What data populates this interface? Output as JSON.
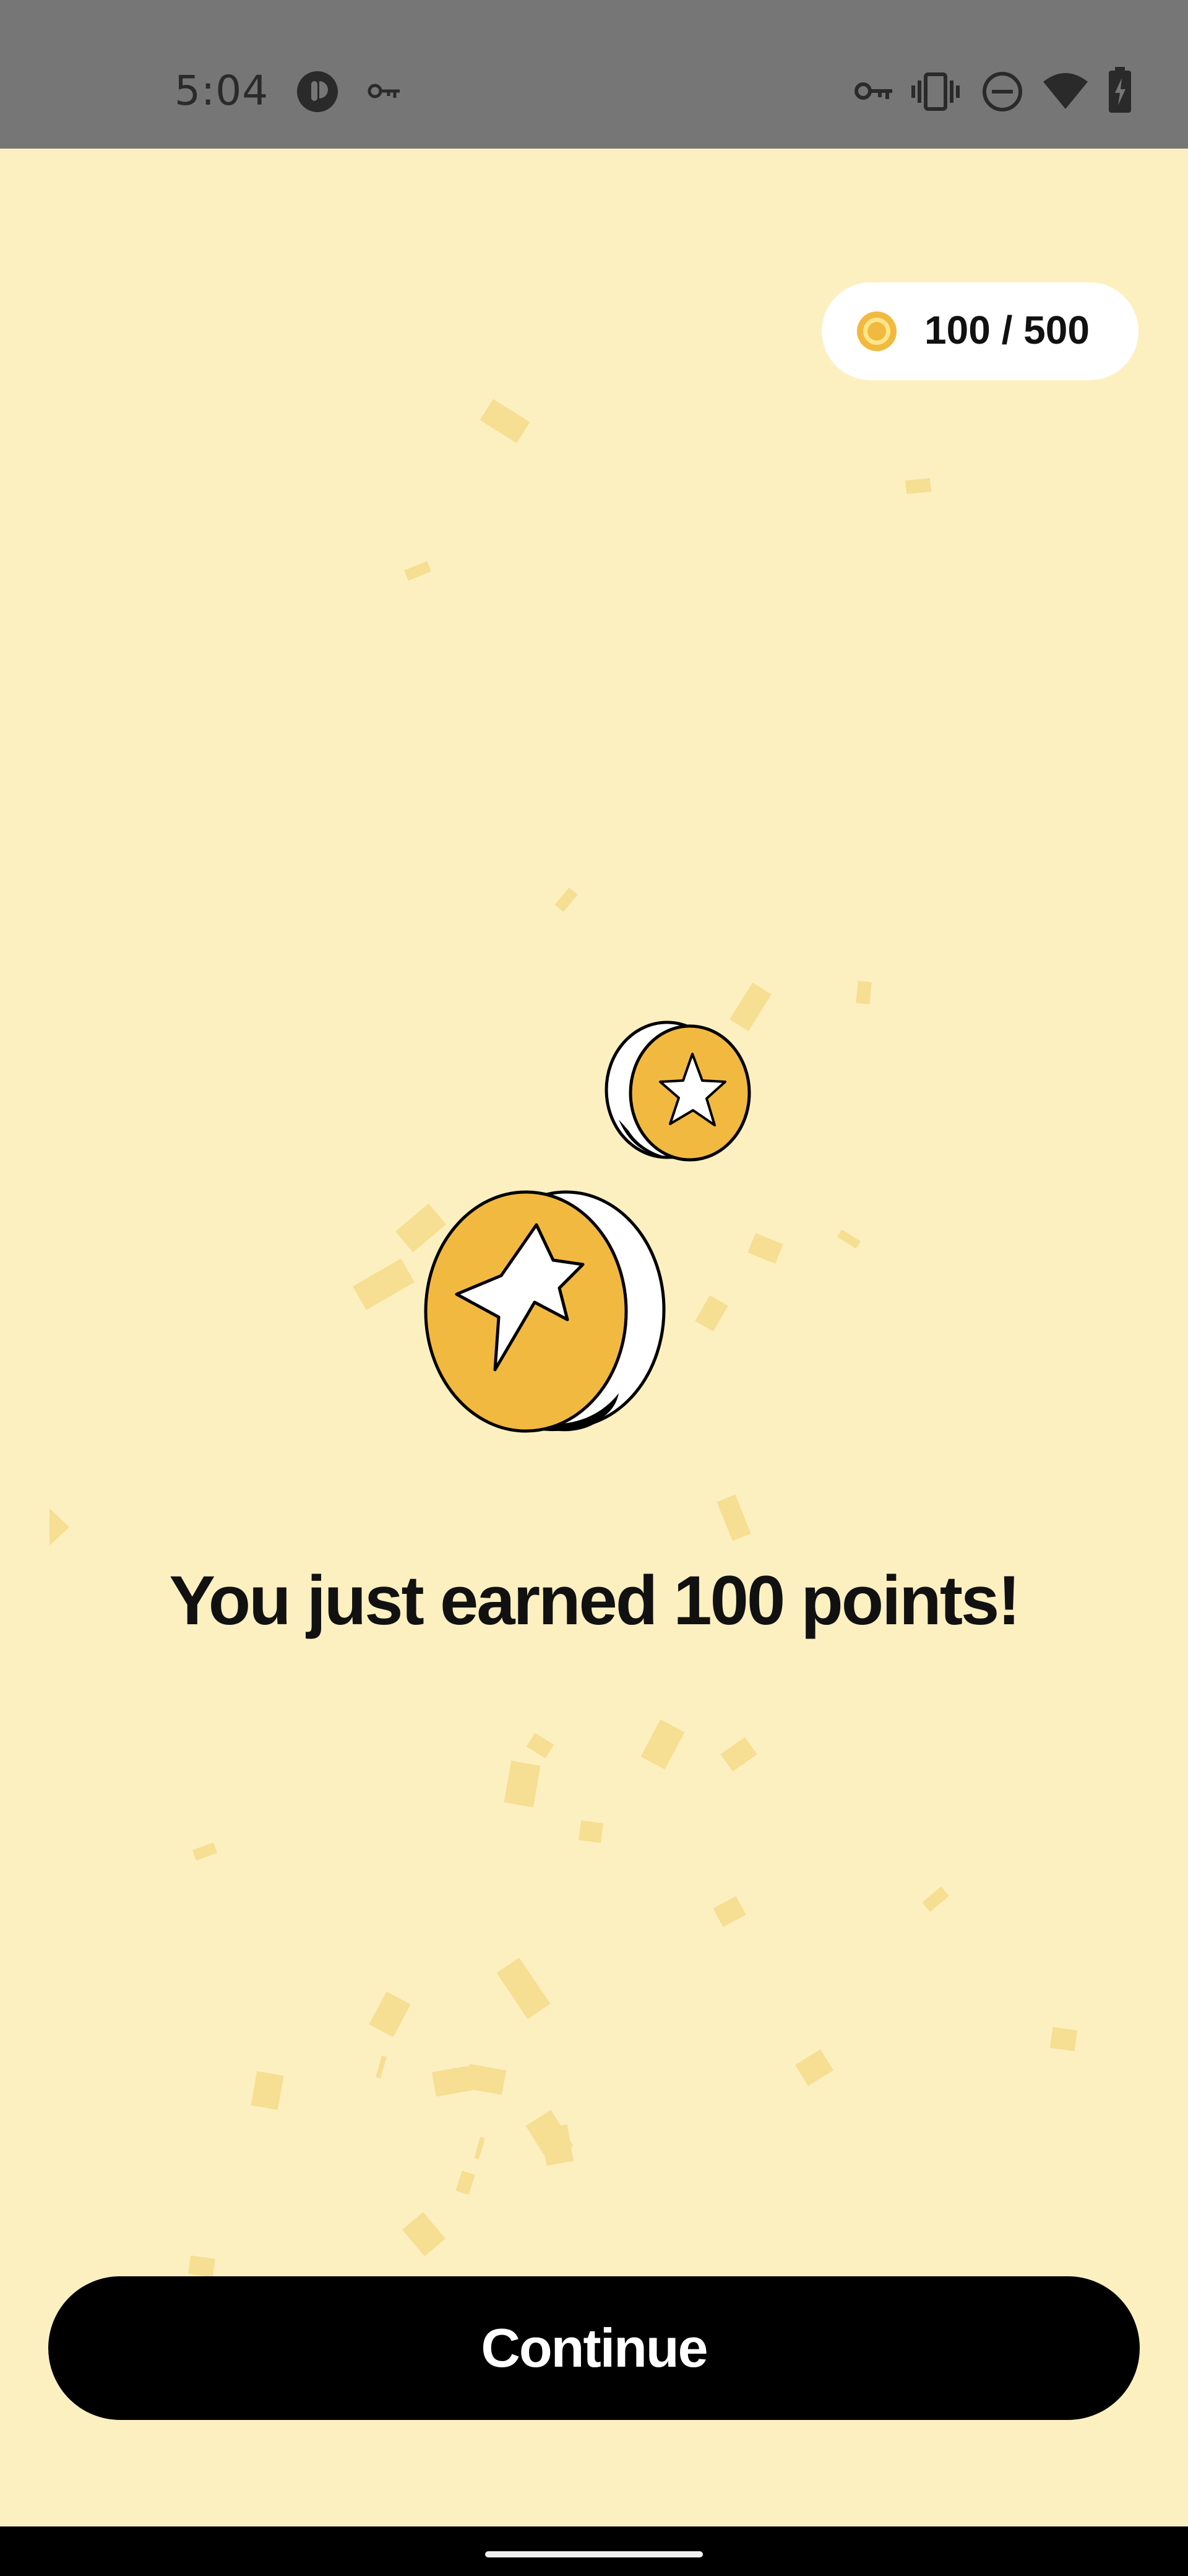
{
  "status_bar": {
    "time": "5:04",
    "icons": [
      "app-notification-icon",
      "vpn-key-icon",
      "key-icon",
      "vibrate-icon",
      "do-not-disturb-icon",
      "wifi-icon",
      "battery-charging-icon"
    ]
  },
  "points": {
    "text": "100 / 500",
    "icon": "coin-icon"
  },
  "reward": {
    "icon": "star-coins-icon",
    "message": "You just earned 100 points!"
  },
  "actions": {
    "continue_label": "Continue"
  },
  "colors": {
    "background": "#FCF0C1",
    "accent": "#F2B940",
    "confetti": "#F6DE92",
    "button": "#000000"
  }
}
